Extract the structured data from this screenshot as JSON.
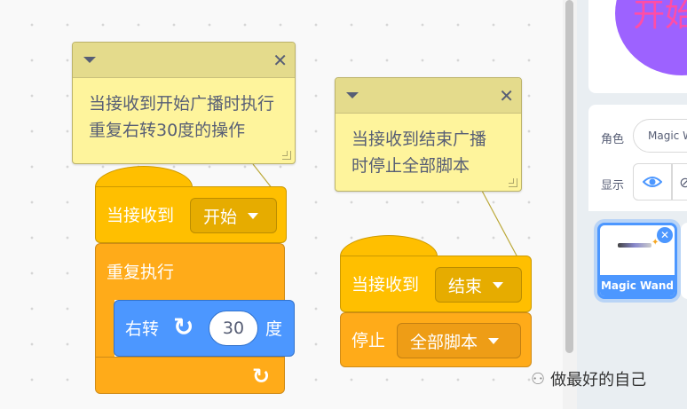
{
  "comments": [
    {
      "text": "当接收到开始广播时执行重复右转30度的操作"
    },
    {
      "text": "当接收到结束广播时停止全部脚本"
    }
  ],
  "script1": {
    "hat_label": "当接收到",
    "hat_dropdown": "开始",
    "repeat_label": "重复执行",
    "turn_label": "右转",
    "turn_value": "30",
    "turn_unit": "度"
  },
  "script2": {
    "hat_label": "当接收到",
    "hat_dropdown": "结束",
    "stop_label": "停止",
    "stop_dropdown": "全部脚本"
  },
  "stage": {
    "preview_text": "开始"
  },
  "sprite_info": {
    "sprite_label": "角色",
    "sprite_name": "Magic Wand",
    "show_label": "显示"
  },
  "sprites": [
    {
      "name": "Magic Wand"
    }
  ],
  "watermark": {
    "text": "做最好的自己"
  },
  "colors": {
    "event": "#ffbf00",
    "control": "#ffab19",
    "motion": "#4c97ff",
    "comment": "#fef49c"
  }
}
